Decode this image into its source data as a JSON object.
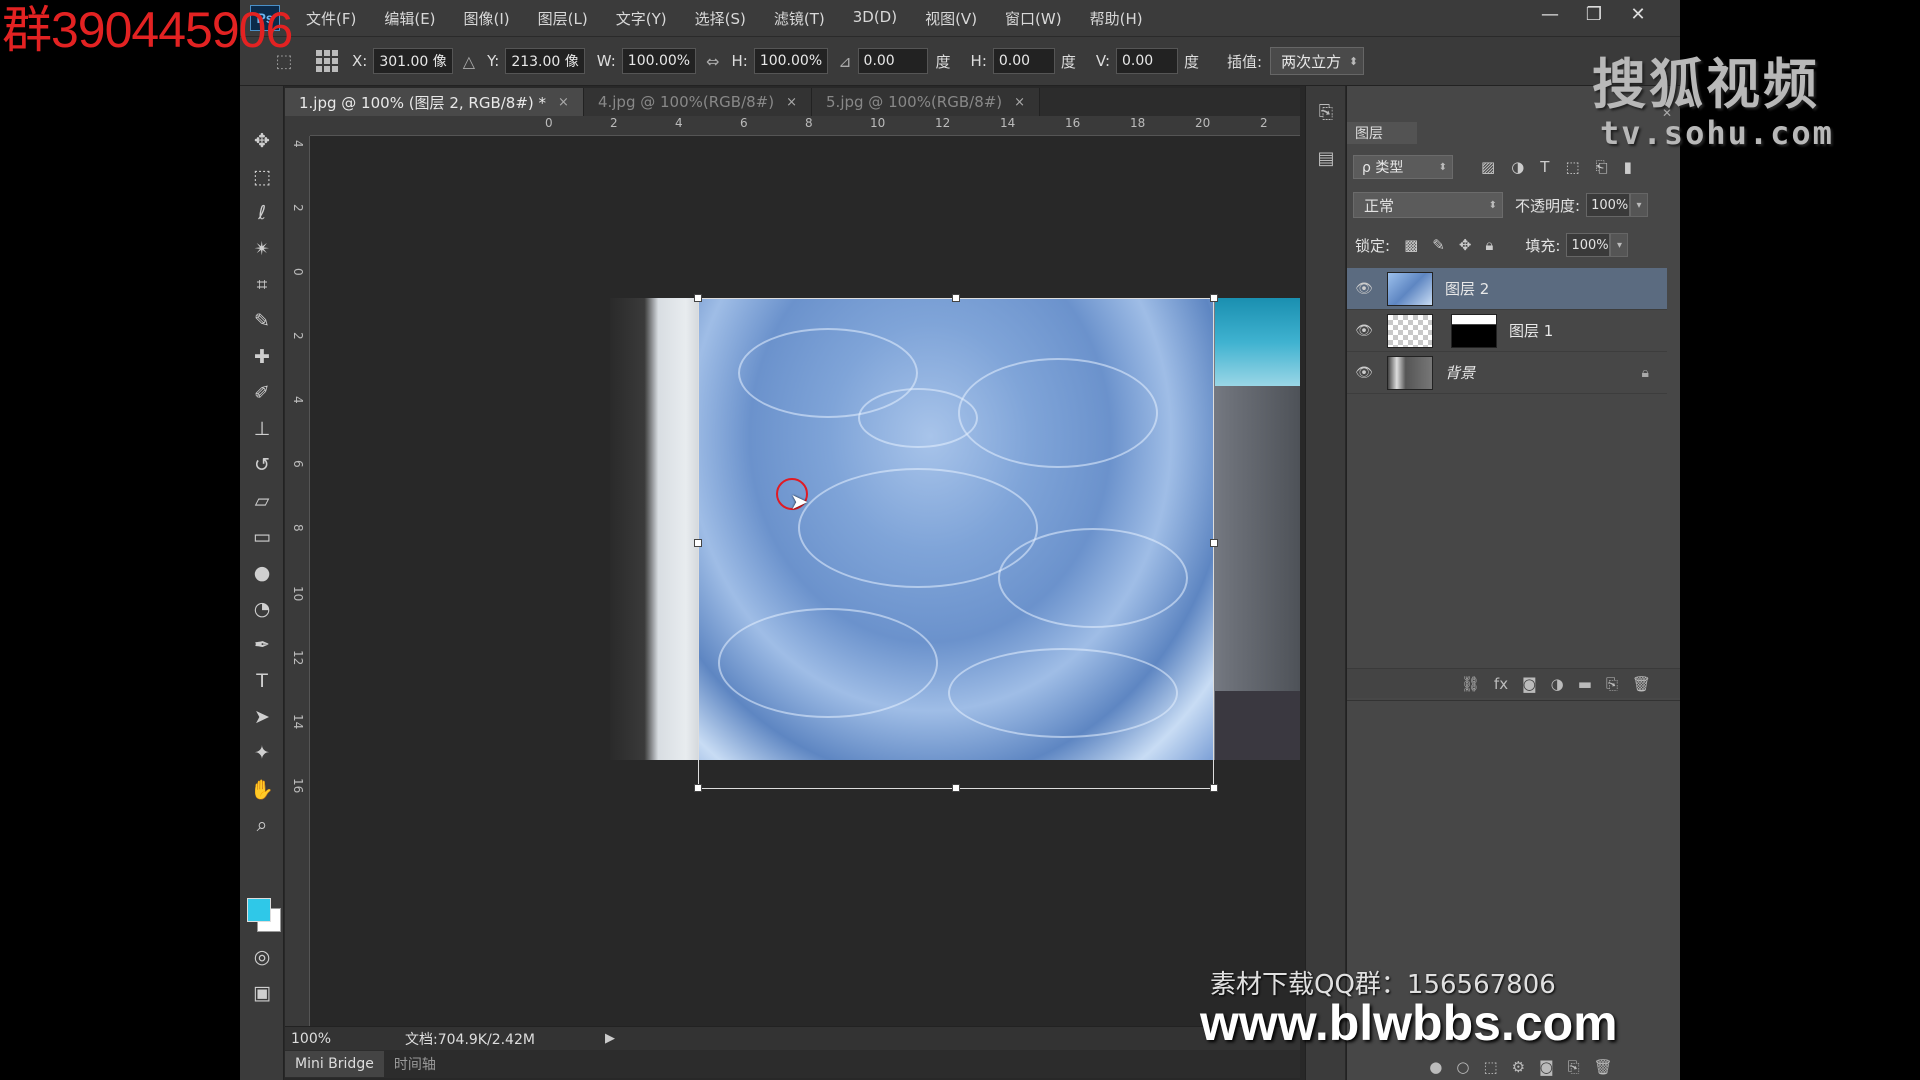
{
  "overlay": {
    "qq_group": "群390445906",
    "sohu_brand": "搜狐视频",
    "sohu_url": "tv.sohu.com",
    "material_qq": "素材下载QQ群：156567806",
    "site_url": "www.blwbbs.com"
  },
  "app": {
    "logo": "Ps"
  },
  "menu": [
    "文件(F)",
    "编辑(E)",
    "图像(I)",
    "图层(L)",
    "文字(Y)",
    "选择(S)",
    "滤镜(T)",
    "3D(D)",
    "视图(V)",
    "窗口(W)",
    "帮助(H)"
  ],
  "window_buttons": {
    "minimize": "—",
    "restore": "❐",
    "close": "✕"
  },
  "options": {
    "x_label": "X:",
    "x_value": "301.00 像",
    "delta": "△",
    "y_label": "Y:",
    "y_value": "213.00 像",
    "w_label": "W:",
    "w_value": "100.00%",
    "link": "⇔",
    "h_label": "H:",
    "h_value": "100.00%",
    "angle_icon": "⊿",
    "angle_value": "0.00",
    "angle_unit": "度",
    "hskew_label": "H:",
    "hskew_value": "0.00",
    "hskew_unit": "度",
    "vskew_label": "V:",
    "vskew_value": "0.00",
    "vskew_unit": "度",
    "interp_label": "插值:",
    "interp_value": "两次立方"
  },
  "tabs": [
    {
      "label": "1.jpg @ 100% (图层 2, RGB/8#) *",
      "active": true
    },
    {
      "label": "4.jpg @ 100%(RGB/8#)",
      "active": false
    },
    {
      "label": "5.jpg @ 100%(RGB/8#)",
      "active": false
    }
  ],
  "tab_close": "×",
  "ruler": {
    "top": [
      "0",
      "2",
      "4",
      "6",
      "8",
      "10",
      "12",
      "14",
      "16",
      "18",
      "20",
      "2"
    ],
    "left": [
      "4",
      "2",
      "0",
      "2",
      "4",
      "6",
      "8",
      "10",
      "12",
      "14",
      "16"
    ]
  },
  "status": {
    "zoom": "100%",
    "doc_info": "文档:704.9K/2.42M",
    "arrow": "▶"
  },
  "bottom_tabs": [
    "Mini Bridge",
    "时间轴"
  ],
  "layers_panel": {
    "title": "图层",
    "filter": "ρ 类型",
    "blend_mode": "正常",
    "opacity_label": "不透明度:",
    "opacity_value": "100%",
    "lock_label": "锁定:",
    "fill_label": "填充:",
    "fill_value": "100%",
    "layers": [
      {
        "name": "图层 2",
        "selected": true
      },
      {
        "name": "图层 1",
        "selected": false
      },
      {
        "name": "背景",
        "selected": false,
        "locked": true
      }
    ]
  }
}
